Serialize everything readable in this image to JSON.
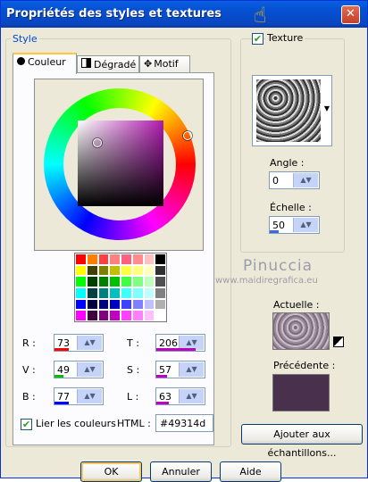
{
  "window": {
    "title": "Propriétés des styles et textures",
    "close_symbol": "✕"
  },
  "style_group": {
    "label": "Style"
  },
  "tabs": [
    {
      "label": "Couleur",
      "icon": "color-dot-icon"
    },
    {
      "label": "Dégradé",
      "icon": "gradient-icon"
    },
    {
      "label": "Motif",
      "icon": "pattern-icon"
    }
  ],
  "palette": [
    "#ff0000",
    "#ff8000",
    "#ff4040",
    "#ff8080",
    "#ff6080",
    "#ff8c8c",
    "#ffc0c0",
    "#000000",
    "#ffff00",
    "#404000",
    "#808000",
    "#c0c000",
    "#ffff40",
    "#ffff80",
    "#ffffc0",
    "#303030",
    "#00ff00",
    "#004000",
    "#008000",
    "#00c000",
    "#40ff40",
    "#80ff80",
    "#c0ffc0",
    "#505050",
    "#00ffff",
    "#004040",
    "#008080",
    "#00c0c0",
    "#40ffff",
    "#80ffff",
    "#c0ffff",
    "#808080",
    "#0000ff",
    "#000040",
    "#000080",
    "#0000c0",
    "#4040ff",
    "#8080ff",
    "#c0c0ff",
    "#b0b0b0",
    "#ff00ff",
    "#400040",
    "#800080",
    "#c000c0",
    "#ff40ff",
    "#ff80ff",
    "#ffc0ff",
    "#ffffff"
  ],
  "fields": {
    "r": {
      "label": "R :",
      "value": "73",
      "color": "#ff0000",
      "fraction": 0.286
    },
    "v": {
      "label": "V :",
      "value": "49",
      "color": "#00c000",
      "fraction": 0.192
    },
    "b": {
      "label": "B :",
      "value": "77",
      "color": "#0000ff",
      "fraction": 0.302
    },
    "t": {
      "label": "T :",
      "value": "206",
      "color": "#c000c0",
      "fraction": 0.808
    },
    "s": {
      "label": "S :",
      "value": "57",
      "color": "#c000c0",
      "fraction": 0.224
    },
    "l": {
      "label": "L :",
      "value": "63",
      "color": "#c000c0",
      "fraction": 0.247
    }
  },
  "link_colors": {
    "label": "Lier les couleurs",
    "checked": "✔"
  },
  "html": {
    "label": "HTML :",
    "value": "#49314d"
  },
  "texture": {
    "label": "Texture",
    "checked": "✔"
  },
  "angle": {
    "label": "Angle :",
    "value": "0"
  },
  "scale": {
    "label": "Échelle :",
    "value": "50"
  },
  "current": {
    "label": "Actuelle :"
  },
  "previous": {
    "label": "Précédente :",
    "color": "#49314d"
  },
  "watermark": {
    "name": "Pinuccia",
    "url": "www.maidiregrafica.eu"
  },
  "buttons": {
    "add_samples": "Ajouter aux échantillons...",
    "ok": "OK",
    "cancel": "Annuler",
    "help": "Aide"
  }
}
